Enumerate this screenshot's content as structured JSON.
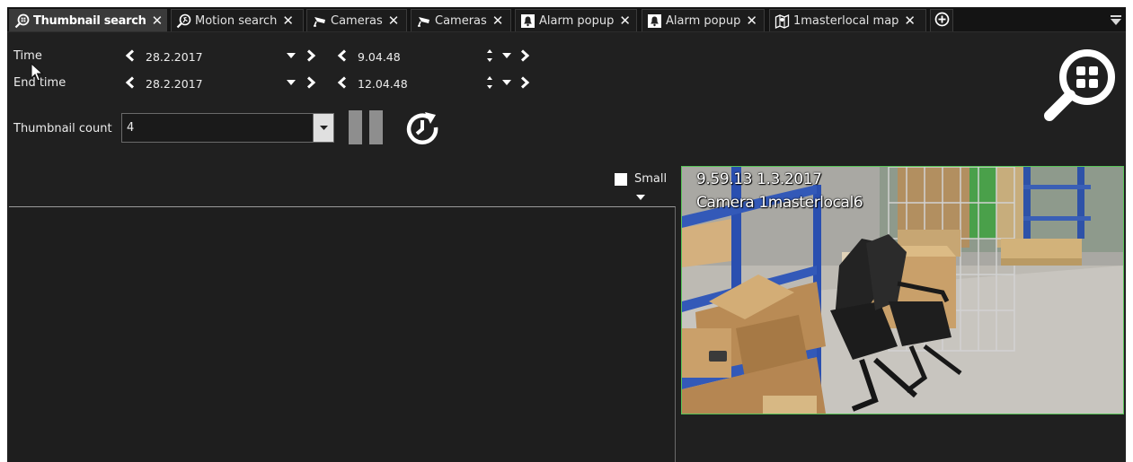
{
  "tabs": [
    {
      "label": "Thumbnail search",
      "icon": "thumbnail-search-icon",
      "active": true
    },
    {
      "label": "Motion search",
      "icon": "motion-search-icon",
      "active": false
    },
    {
      "label": "Cameras",
      "icon": "camera-icon",
      "active": false
    },
    {
      "label": "Cameras",
      "icon": "camera-icon",
      "active": false
    },
    {
      "label": "Alarm popup",
      "icon": "bell-icon",
      "active": false
    },
    {
      "label": "Alarm popup",
      "icon": "bell-icon",
      "active": false
    },
    {
      "label": "1masterlocal map",
      "icon": "map-icon",
      "active": false
    }
  ],
  "filters": {
    "time_label": "Time",
    "end_time_label": "End time",
    "start_date": "28.2.2017",
    "start_time": "9.04.48",
    "end_date": "28.2.2017",
    "end_time": "12.04.48",
    "thumbnail_count_label": "Thumbnail count",
    "thumbnail_count_value": "4"
  },
  "view_options": {
    "small_label": "Small",
    "small_checked": false
  },
  "thumbnail": {
    "timestamp": "9.59.13  1.3.2017",
    "camera_name": "Camera 1masterlocal6"
  },
  "colors": {
    "background": "#202020",
    "tab_bar": "#141414",
    "active_tab": "#3a3a3a",
    "selected_border": "#58c458"
  }
}
